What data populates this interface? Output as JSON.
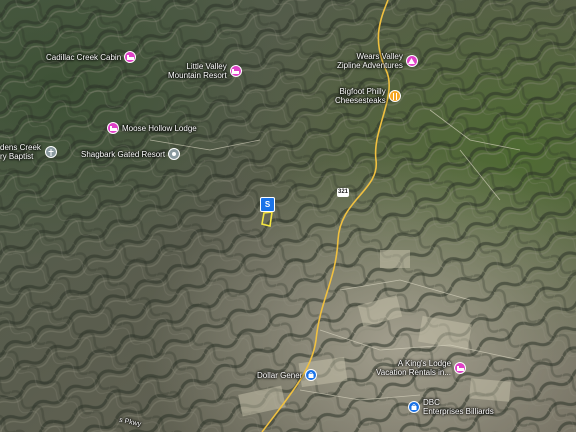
{
  "map": {
    "colors": {
      "hotel_pin": "#e040c8",
      "food_pin": "#f5a623",
      "shopping_pin": "#1a73e8",
      "place_pin": "#8a9aa0",
      "road": "#f0c040",
      "parcel_outline": "#f5e642",
      "marker": "#1a73e8"
    },
    "pois": {
      "cadillac_creek": "Cadillac Creek Cabin",
      "little_valley_1": "Little Valley",
      "little_valley_2": "Mountain Resort",
      "moose_hollow": "Moose Hollow Lodge",
      "shagbark": "Shagbark Gated Resort",
      "dens_creek_1": "dens Creek",
      "dens_creek_2": "ry Baptist",
      "wears_valley_1": "Wears Valley",
      "wears_valley_2": "Zipline Adventures",
      "bigfoot_1": "Bigfoot Philly",
      "bigfoot_2": "Cheesesteaks",
      "dollar_general": "Dollar Gener",
      "kings_lodge_1": "A King's Lodge",
      "kings_lodge_2": "Vacation Rentals in...",
      "dbc_1": "DBC",
      "dbc_2": "Enterprises Billiards",
      "road_label": "s Pkwy"
    },
    "highway_shield": "321",
    "marker_label": "S"
  }
}
